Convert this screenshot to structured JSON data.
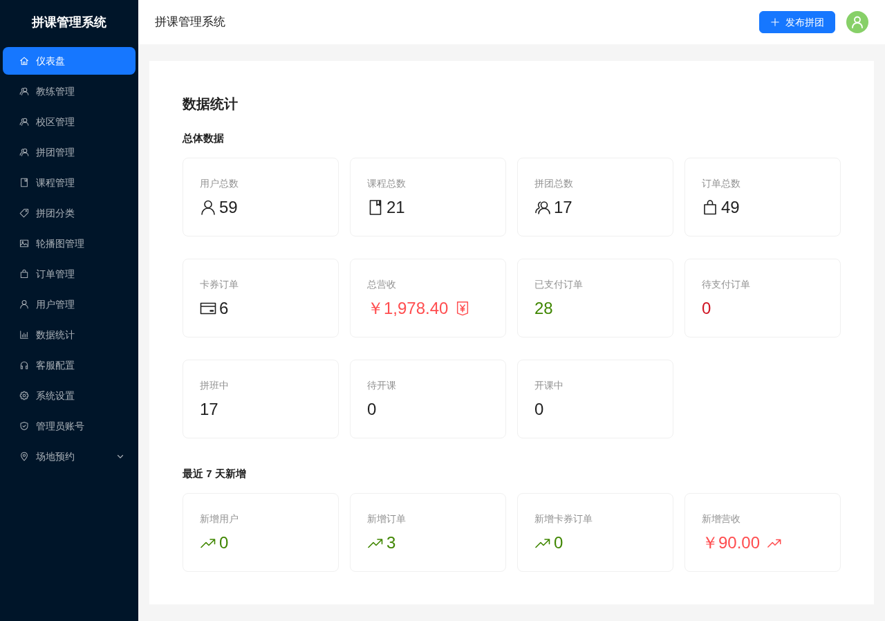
{
  "sidebar": {
    "title": "拼课管理系统",
    "items": [
      {
        "label": "仪表盘",
        "selected": true
      },
      {
        "label": "教练管理",
        "selected": false
      },
      {
        "label": "校区管理",
        "selected": false
      },
      {
        "label": "拼团管理",
        "selected": false
      },
      {
        "label": "课程管理",
        "selected": false
      },
      {
        "label": "拼团分类",
        "selected": false
      },
      {
        "label": "轮播图管理",
        "selected": false
      },
      {
        "label": "订单管理",
        "selected": false
      },
      {
        "label": "用户管理",
        "selected": false
      },
      {
        "label": "数据统计",
        "selected": false
      },
      {
        "label": "客服配置",
        "selected": false
      },
      {
        "label": "系统设置",
        "selected": false
      },
      {
        "label": "管理员账号",
        "selected": false
      },
      {
        "label": "场地预约",
        "selected": false,
        "expanded": false
      }
    ]
  },
  "header": {
    "title": "拼课管理系统",
    "action_button": "发布拼团"
  },
  "page": {
    "title": "数据统计",
    "sections": [
      {
        "title": "总体数据",
        "cards": [
          {
            "label": "用户总数",
            "value": "59",
            "color": "#1f1f1f"
          },
          {
            "label": "课程总数",
            "value": "21",
            "color": "#1f1f1f"
          },
          {
            "label": "拼团总数",
            "value": "17",
            "color": "#1f1f1f"
          },
          {
            "label": "订单总数",
            "value": "49",
            "color": "#1f1f1f"
          },
          {
            "label": "卡券订单",
            "value": "6",
            "color": "#1f1f1f"
          },
          {
            "label": "总营收",
            "value": "￥1,978.40",
            "color": "#ff4d4f"
          },
          {
            "label": "已支付订单",
            "value": "28",
            "color": "#3f8600"
          },
          {
            "label": "待支付订单",
            "value": "0",
            "color": "#cf1322"
          },
          {
            "label": "拼班中",
            "value": "17",
            "color": "#1f1f1f"
          },
          {
            "label": "待开课",
            "value": "0",
            "color": "#1f1f1f"
          },
          {
            "label": "开课中",
            "value": "0",
            "color": "#1f1f1f"
          }
        ]
      },
      {
        "title": "最近 7 天新增",
        "cards": [
          {
            "label": "新增用户",
            "value": "0",
            "color": "#3f8600"
          },
          {
            "label": "新增订单",
            "value": "3",
            "color": "#3f8600"
          },
          {
            "label": "新增卡券订单",
            "value": "0",
            "color": "#3f8600"
          },
          {
            "label": "新增营收",
            "value": "￥90.00",
            "color": "#ff4d4f"
          }
        ]
      }
    ]
  }
}
